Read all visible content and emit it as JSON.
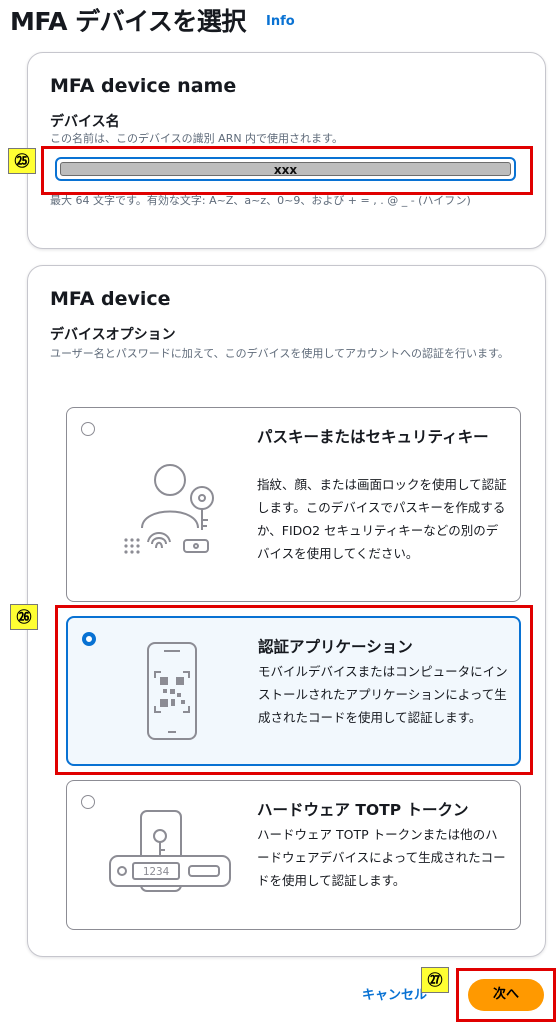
{
  "header": {
    "title": "MFA デバイスを選択",
    "info_label": "Info"
  },
  "device_name_card": {
    "title": "MFA device name",
    "field_label": "デバイス名",
    "field_description": "この名前は、このデバイスの識別 ARN 内で使用されます。",
    "input_value": "xxx",
    "constraint": "最大 64 文字です。有効な文字: A~Z、a~z、0~9、および + = , . @ _ - (ハイフン)"
  },
  "device_card": {
    "title": "MFA device",
    "field_label": "デバイスオプション",
    "field_description": "ユーザー名とパスワードに加えて、このデバイスを使用してアカウントへの認証を行います。",
    "options": [
      {
        "title": "パスキーまたはセキュリティキー",
        "description": "指紋、顔、または画面ロックを使用して認証します。このデバイスでパスキーを作成するか、FIDO2 セキュリティキーなどの別のデバイスを使用してください。",
        "selected": false,
        "icon": "passkey-icon"
      },
      {
        "title": "認証アプリケーション",
        "description": "モバイルデバイスまたはコンピュータにインストールされたアプリケーションによって生成されたコードを使用して認証します。",
        "selected": true,
        "icon": "phone-qr-icon"
      },
      {
        "title": "ハードウェア TOTP トークン",
        "description": "ハードウェア TOTP トークンまたは他のハードウェアデバイスによって生成されたコードを使用して認証します。",
        "selected": false,
        "icon": "hardware-token-icon",
        "token_display": "1234"
      }
    ]
  },
  "footer": {
    "cancel_label": "キャンセル",
    "next_label": "次へ"
  },
  "annotations": {
    "step_25": "㉕",
    "step_26": "㉖",
    "step_27": "㉗"
  },
  "colors": {
    "accent": "#0972d3",
    "primary_button": "#ff9900",
    "highlight_box": "#e00000",
    "badge": "#ffff33"
  }
}
